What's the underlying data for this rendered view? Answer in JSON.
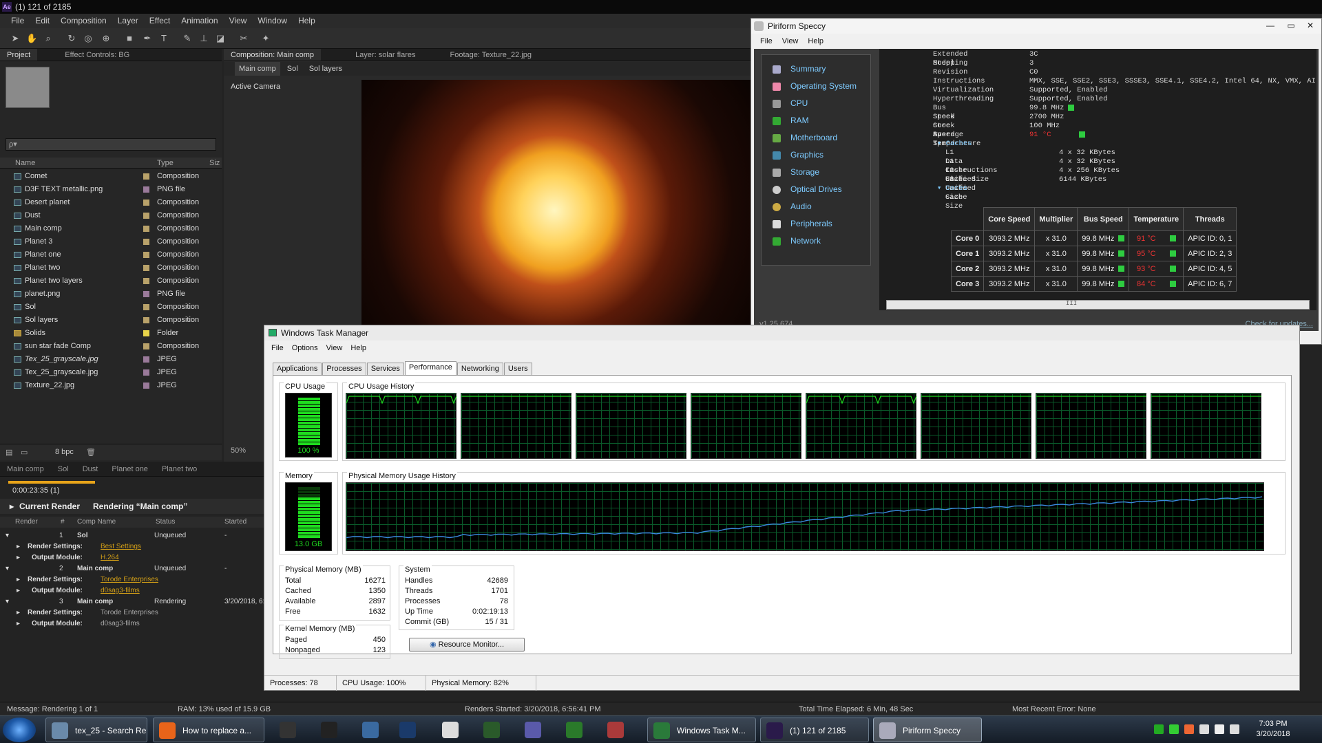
{
  "ae": {
    "title": "(1) 121 of 2185",
    "logo": "Ae",
    "menu": [
      "File",
      "Edit",
      "Composition",
      "Layer",
      "Effect",
      "Animation",
      "View",
      "Window",
      "Help"
    ],
    "tools": [
      "arrow-icon",
      "hand-icon",
      "zoom-icon",
      "rotate-icon",
      "camera-icon",
      "pan-icon",
      "rect-icon",
      "pen-icon",
      "type-icon",
      "brush-icon",
      "stamp-icon",
      "eraser-icon",
      "roto-icon",
      "puppet-icon"
    ],
    "project_tabs": [
      "Project",
      "Effect Controls: BG"
    ],
    "search_placeholder": "ρ▾",
    "columns": {
      "name": "Name",
      "type": "Type",
      "size": "Siz"
    },
    "items": [
      {
        "name": "Comet",
        "type": "Composition"
      },
      {
        "name": "D3F TEXT metallic.png",
        "type": "PNG file"
      },
      {
        "name": "Desert planet",
        "type": "Composition"
      },
      {
        "name": "Dust",
        "type": "Composition"
      },
      {
        "name": "Main comp",
        "type": "Composition"
      },
      {
        "name": "Planet 3",
        "type": "Composition"
      },
      {
        "name": "Planet one",
        "type": "Composition"
      },
      {
        "name": "Planet two",
        "type": "Composition"
      },
      {
        "name": "Planet two layers",
        "type": "Composition"
      },
      {
        "name": "planet.png",
        "type": "PNG file"
      },
      {
        "name": "Sol",
        "type": "Composition"
      },
      {
        "name": "Sol layers",
        "type": "Composition"
      },
      {
        "name": "Solids",
        "type": "Folder"
      },
      {
        "name": "sun star fade Comp",
        "type": "Composition"
      },
      {
        "name": "Tex_25_grayscale.jpg",
        "type": "JPEG"
      },
      {
        "name": "Tex_25_grayscale.jpg",
        "type": "JPEG"
      },
      {
        "name": "Texture_22.jpg",
        "type": "JPEG"
      }
    ],
    "bpc": "8 bpc",
    "comp_tabs": [
      "Composition: Main comp",
      "Layer: solar flares",
      "Footage: Texture_22.jpg"
    ],
    "crumbs": [
      "Main comp",
      "Sol",
      "Sol layers"
    ],
    "active_camera": "Active Camera",
    "zoom": "50%",
    "timeline_tabs": [
      "Main comp",
      "Sol",
      "Dust",
      "Planet one",
      "Planet two"
    ],
    "elapsed": "0:00:23:35 (1)",
    "current_render_label": "Current Render",
    "rendering_label": "Rendering “Main comp”",
    "rq_cols": [
      "Render",
      "#",
      "Comp Name",
      "Status",
      "Started"
    ],
    "rq": [
      {
        "n": "1",
        "comp": "Sol",
        "status": "Unqueued",
        "started": "-",
        "settings": "Best Settings",
        "module": "H.264"
      },
      {
        "n": "2",
        "comp": "Main comp",
        "status": "Unqueued",
        "started": "-",
        "settings": "Torode Enterprises",
        "module": "d0sag3-films"
      },
      {
        "n": "3",
        "comp": "Main comp",
        "status": "Rendering",
        "started": "3/20/2018, 6:",
        "settings": "Torode Enterprises",
        "module": "d0sag3-films"
      }
    ],
    "render_settings_label": "Render Settings:",
    "output_module_label": "Output Module:",
    "status": {
      "message": "Message: Rendering 1 of 1",
      "ram": "RAM: 13% used of 15.9 GB",
      "renders_started": "Renders Started: 3/20/2018, 6:56:41 PM",
      "elapsed": "Total Time Elapsed: 6 Min, 48 Sec",
      "error": "Most Recent Error: None"
    }
  },
  "speccy": {
    "title": "Piriform Speccy",
    "menu": [
      "File",
      "View",
      "Help"
    ],
    "nav": [
      "Summary",
      "Operating System",
      "CPU",
      "RAM",
      "Motherboard",
      "Graphics",
      "Storage",
      "Optical Drives",
      "Audio",
      "Peripherals",
      "Network"
    ],
    "props": [
      {
        "k": "Extended Model",
        "v": "3C"
      },
      {
        "k": "Stepping",
        "v": "3"
      },
      {
        "k": "Revision",
        "v": "C0"
      },
      {
        "k": "Instructions",
        "v": "MMX, SSE, SSE2, SSE3, SSSE3, SSE4.1, SSE4.2, Intel 64, NX, VMX, AI"
      },
      {
        "k": "Virtualization",
        "v": "Supported, Enabled"
      },
      {
        "k": "Hyperthreading",
        "v": "Supported, Enabled"
      },
      {
        "k": "Bus Speed",
        "v": "99.8 MHz"
      },
      {
        "k": "Stock Core Speed",
        "v": "2700 MHz"
      },
      {
        "k": "Stock Bus Speed",
        "v": "100 MHz"
      },
      {
        "k": "Average Temperature",
        "v": "91 °C"
      }
    ],
    "caches_label": "Caches",
    "caches": [
      {
        "k": "L1 Data Cache Size",
        "v": "4 x 32 KBytes"
      },
      {
        "k": "L1 Instructions Cache Size",
        "v": "4 x 32 KBytes"
      },
      {
        "k": "L2 Unified Cache Size",
        "v": "4 x 256 KBytes"
      },
      {
        "k": "L3 Unified Cache Size",
        "v": "6144 KBytes"
      }
    ],
    "cores_label": "Cores",
    "core_headers": [
      "Core Speed",
      "Multiplier",
      "Bus Speed",
      "Temperature",
      "Threads"
    ],
    "cores": [
      {
        "name": "Core 0",
        "speed": "3093.2 MHz",
        "mult": "x 31.0",
        "bus": "99.8 MHz",
        "temp": "91 °C",
        "threads": "APIC ID: 0, 1"
      },
      {
        "name": "Core 1",
        "speed": "3093.2 MHz",
        "mult": "x 31.0",
        "bus": "99.8 MHz",
        "temp": "95 °C",
        "threads": "APIC ID: 2, 3"
      },
      {
        "name": "Core 2",
        "speed": "3093.2 MHz",
        "mult": "x 31.0",
        "bus": "99.8 MHz",
        "temp": "93 °C",
        "threads": "APIC ID: 4, 5"
      },
      {
        "name": "Core 3",
        "speed": "3093.2 MHz",
        "mult": "x 31.0",
        "bus": "99.8 MHz",
        "temp": "84 °C",
        "threads": "APIC ID: 6, 7"
      }
    ],
    "scroll_mark": "III",
    "version": "v1.25.674",
    "check_updates": "Check for updates..."
  },
  "tm": {
    "title": "Windows Task Manager",
    "menu": [
      "File",
      "Options",
      "View",
      "Help"
    ],
    "tabs": [
      "Applications",
      "Processes",
      "Services",
      "Performance",
      "Networking",
      "Users"
    ],
    "cpu_usage_label": "CPU Usage",
    "cpu_usage_value": "100 %",
    "cpu_history_label": "CPU Usage History",
    "memory_label": "Memory",
    "memory_value": "13.0 GB",
    "mem_history_label": "Physical Memory Usage History",
    "cpu_fraction": 1.0,
    "mem_fraction": 0.82,
    "physical_label": "Physical Memory (MB)",
    "physical": [
      {
        "k": "Total",
        "v": "16271"
      },
      {
        "k": "Cached",
        "v": "1350"
      },
      {
        "k": "Available",
        "v": "2897"
      },
      {
        "k": "Free",
        "v": "1632"
      }
    ],
    "kernel_label": "Kernel Memory (MB)",
    "kernel": [
      {
        "k": "Paged",
        "v": "450"
      },
      {
        "k": "Nonpaged",
        "v": "123"
      }
    ],
    "system_label": "System",
    "system": [
      {
        "k": "Handles",
        "v": "42689"
      },
      {
        "k": "Threads",
        "v": "1701"
      },
      {
        "k": "Processes",
        "v": "78"
      },
      {
        "k": "Up Time",
        "v": "0:02:19:13"
      },
      {
        "k": "Commit (GB)",
        "v": "15 / 31"
      }
    ],
    "resource_monitor": "Resource Monitor...",
    "status": {
      "processes": "Processes: 78",
      "cpu": "CPU Usage: 100%",
      "mem": "Physical Memory: 82%"
    }
  },
  "taskbar": {
    "items": [
      {
        "label": "tex_25 - Search Re...",
        "icon": "search-icon",
        "color": "#6a8aaa"
      },
      {
        "label": "How to replace a...",
        "icon": "firefox-icon",
        "color": "#e8641a"
      },
      {
        "label": "",
        "icon": "davinci-icon",
        "color": "#333"
      },
      {
        "label": "",
        "icon": "soundforge-icon",
        "color": "#222"
      },
      {
        "label": "",
        "icon": "calculator-icon",
        "color": "#3a6aa0"
      },
      {
        "label": "",
        "icon": "photoshop-icon",
        "color": "#1a3a6a"
      },
      {
        "label": "",
        "icon": "notepad-icon",
        "color": "#ddd"
      },
      {
        "label": "",
        "icon": "terminal-icon",
        "color": "#2a5a2a"
      },
      {
        "label": "",
        "icon": "network-icon",
        "color": "#5a5aaa"
      },
      {
        "label": "",
        "icon": "excel-icon",
        "color": "#2a7a2a"
      },
      {
        "label": "",
        "icon": "tool-icon",
        "color": "#aa3a3a"
      },
      {
        "label": "Windows Task M...",
        "icon": "taskmanager-icon",
        "color": "#2a7a3a"
      },
      {
        "label": "(1) 121 of 2185",
        "icon": "aftereffects-icon",
        "color": "#2a1a4a"
      },
      {
        "label": "Piriform Speccy",
        "icon": "speccy-icon",
        "color": "#aab"
      }
    ],
    "time": "7:03 PM",
    "date": "3/20/2018"
  },
  "colors": {
    "accent": "#e8a41a",
    "graph_green": "#1fdc1f",
    "mem_line": "#3a8adf",
    "link": "#7ecbff",
    "temp": "#e33"
  }
}
